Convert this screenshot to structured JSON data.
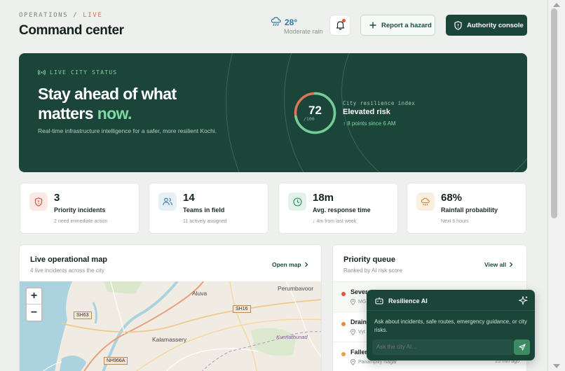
{
  "header": {
    "breadcrumb_section": "OPERATIONS",
    "breadcrumb_sep": "/",
    "breadcrumb_live": "LIVE",
    "title": "Command center",
    "weather_temp": "28°",
    "weather_desc": "Moderate rain",
    "weather_icon": "rain-cloud-icon",
    "report_label": "Report a hazard",
    "console_label": "Authority console"
  },
  "hero": {
    "label": "LIVE CITY STATUS",
    "headline_1": "Stay ahead of what",
    "headline_2": "matters",
    "headline_accent": "now.",
    "subtitle": "Real-time infrastructure intelligence for a safer, more resilient Kochi.",
    "score": "72",
    "score_max": "/100",
    "score_fraction": 0.72,
    "index_label": "City resilience index",
    "risk_level": "Elevated risk",
    "delta": "↑ 8 points since 6 AM"
  },
  "stats": [
    {
      "value": "3",
      "label": "Priority incidents",
      "sub": "2 need immediate action",
      "icon": "shield-alert-icon"
    },
    {
      "value": "14",
      "label": "Teams in field",
      "sub": "11 actively assigned",
      "icon": "users-icon"
    },
    {
      "value": "18m",
      "label": "Avg. response time",
      "sub": "↓ 4m from last week",
      "icon": "clock-icon"
    },
    {
      "value": "68%",
      "label": "Rainfall probability",
      "sub": "Next 6 hours",
      "icon": "rain-cloud-icon"
    }
  ],
  "map": {
    "title": "Live operational map",
    "subtitle": "4 live incidents across the city",
    "link": "Open map",
    "zoom_in": "+",
    "zoom_out": "−",
    "places": {
      "aluva": "Aluva",
      "perumbavoor": "Perumbavoor",
      "kalamassery": "Kalamassery",
      "kunnathunad": "Kunnathunad"
    },
    "roads": {
      "sh63": "SH63",
      "sh16": "SH16",
      "nh966a": "NH966A"
    }
  },
  "queue": {
    "title": "Priority queue",
    "subtitle": "Ranked by AI risk score",
    "link": "View all",
    "items": [
      {
        "title": "Severe",
        "location": "MG",
        "time": "",
        "color": "#e2553c"
      },
      {
        "title": "Draina",
        "location": "Vyt",
        "time": "",
        "color": "#e8883d"
      },
      {
        "title": "Fallen",
        "location": "Panampilly Nagar",
        "time": "25 min ago",
        "color": "#e8a23d"
      }
    ]
  },
  "ai": {
    "title": "Resilience AI",
    "body": "Ask about incidents, safe routes, emergency guidance, or city risks.",
    "placeholder": "Ask the city AI..."
  }
}
